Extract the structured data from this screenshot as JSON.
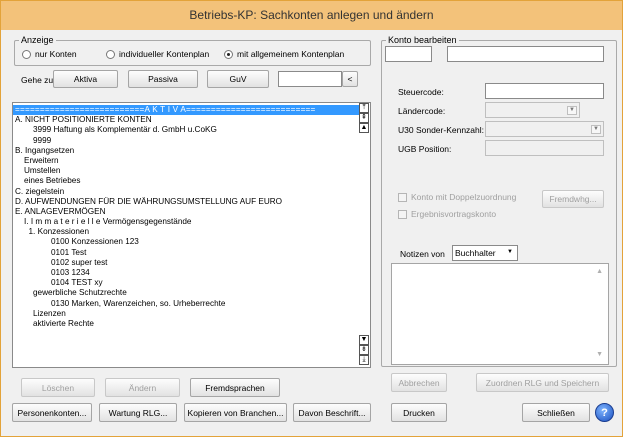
{
  "window": {
    "title": "Betriebs-KP: Sachkonten anlegen und ändern"
  },
  "anzeige": {
    "legend": "Anzeige",
    "options": [
      {
        "label": "nur Konten",
        "selected": false
      },
      {
        "label": "individueller Kontenplan",
        "selected": false
      },
      {
        "label": "mit allgemeinem Kontenplan",
        "selected": true
      }
    ]
  },
  "goto": {
    "label": "Gehe zu",
    "buttons": [
      "Aktiva",
      "Passiva",
      "GuV"
    ],
    "input_value": "",
    "go_button": "<"
  },
  "tree": {
    "rows": [
      {
        "text": "==========================A K T I V A==========================",
        "indent": 0,
        "selected": true
      },
      {
        "text": "A.  NICHT POSITIONIERTE KONTEN",
        "indent": 0
      },
      {
        "text": "3999  Haftung als Komplementär d. GmbH u.CoKG",
        "indent": 2
      },
      {
        "text": "9999",
        "indent": 2
      },
      {
        "text": "B.  Ingangsetzen",
        "indent": 0
      },
      {
        "text": "Erweitern",
        "indent": 1
      },
      {
        "text": "Umstellen",
        "indent": 1
      },
      {
        "text": "eines Betriebes",
        "indent": 1
      },
      {
        "text": "C.  ziegelstein",
        "indent": 0
      },
      {
        "text": "D.  AUFWENDUNGEN FÜR DIE WÄHRUNGSUMSTELLUNG AUF EURO",
        "indent": 0
      },
      {
        "text": "E.  ANLAGEVERMÖGEN",
        "indent": 0
      },
      {
        "text": "I. I m m a t e r i e l l e   Vermögensgegenstände",
        "indent": 1
      },
      {
        "text": "1. Konzessionen",
        "indent": 1.5
      },
      {
        "text": "0100  Konzessionen 123",
        "indent": 4
      },
      {
        "text": "0101  Test",
        "indent": 4
      },
      {
        "text": "0102  super test",
        "indent": 4
      },
      {
        "text": "0103  1234",
        "indent": 4
      },
      {
        "text": "0104  TEST xy",
        "indent": 4
      },
      {
        "text": "gewerbliche Schutzrechte",
        "indent": 2
      },
      {
        "text": "0130  Marken, Warenzeichen, so. Urheberrechte",
        "indent": 4
      },
      {
        "text": "Lizenzen",
        "indent": 2
      },
      {
        "text": "aktivierte Rechte",
        "indent": 2
      }
    ]
  },
  "left_buttons": {
    "loeschen": "Löschen",
    "aendern": "Ändern",
    "fremdsprachen": "Fremdsprachen"
  },
  "bottom_buttons": {
    "personenkonten": "Personenkonten...",
    "wartung": "Wartung RLG...",
    "kopieren": "Kopieren von Branchen...",
    "beschrift": "Davon Beschrift...",
    "drucken": "Drucken",
    "schliessen": "Schließen"
  },
  "konto": {
    "legend": "Konto bearbeiten",
    "number_value": "",
    "name_value": "",
    "steuercode_label": "Steuercode:",
    "steuercode_value": "",
    "laendercode_label": "Ländercode:",
    "laendercode_value": "",
    "u30_label": "U30 Sonder-Kennzahl:",
    "u30_value": "",
    "ugb_label": "UGB Position:",
    "ugb_value": "",
    "doppel_label": "Konto mit Doppelzuordnung",
    "ergebnis_label": "Ergebnisvortragskonto",
    "fremdwhg_button": "Fremdwhg...",
    "notizen_label": "Notizen von",
    "notizen_value": "Buchhalter",
    "notes_text": "",
    "abbrechen_button": "Abbrechen",
    "zuordnen_button": "Zuordnen RLG und Speichern"
  },
  "icons": {
    "dropdown": "chevron-down-icon",
    "help": "help-globe-icon"
  }
}
